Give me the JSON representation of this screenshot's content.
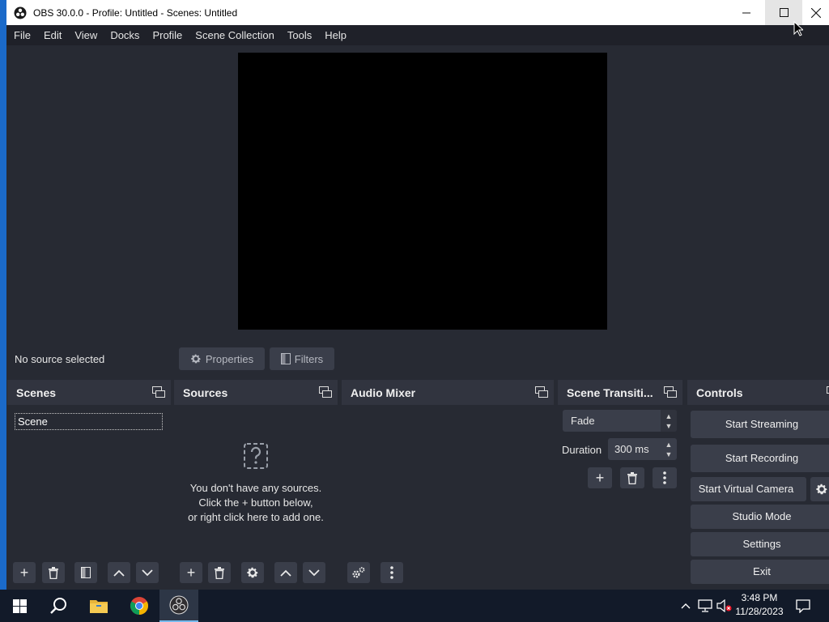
{
  "window": {
    "title": "OBS 30.0.0 - Profile: Untitled - Scenes: Untitled"
  },
  "menu": [
    "File",
    "Edit",
    "View",
    "Docks",
    "Profile",
    "Scene Collection",
    "Tools",
    "Help"
  ],
  "source_bar": {
    "status": "No source selected",
    "properties_label": "Properties",
    "filters_label": "Filters"
  },
  "docks": {
    "scenes": {
      "title": "Scenes",
      "items": [
        "Scene"
      ]
    },
    "sources": {
      "title": "Sources",
      "empty_line1": "You don't have any sources.",
      "empty_line2": "Click the + button below,",
      "empty_line3": "or right click here to add one."
    },
    "mixer": {
      "title": "Audio Mixer"
    },
    "transitions": {
      "title": "Scene Transiti...",
      "transition": "Fade",
      "duration_label": "Duration",
      "duration_value": "300 ms"
    },
    "controls": {
      "title": "Controls",
      "start_streaming": "Start Streaming",
      "start_recording": "Start Recording",
      "start_virtual_camera": "Start Virtual Camera",
      "studio_mode": "Studio Mode",
      "settings": "Settings",
      "exit": "Exit"
    }
  },
  "taskbar": {
    "time": "3:48 PM",
    "date": "11/28/2023"
  },
  "colors": {
    "window_bg": "#272a33",
    "dock_header": "#31343f",
    "button": "#3a3e4a",
    "taskbar": "#121a29"
  }
}
